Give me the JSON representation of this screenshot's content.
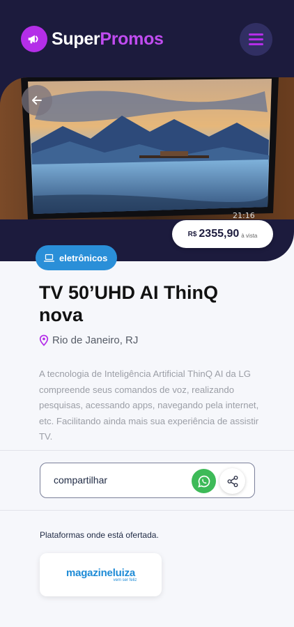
{
  "brand": {
    "super": "Super",
    "promos": "Promos"
  },
  "product": {
    "price_currency": "R$",
    "price_value": "2355,90",
    "price_suffix": "à vista",
    "category": "eletrônicos",
    "title": "TV 50’UHD AI ThinQ nova",
    "location": "Rio de Janeiro, RJ",
    "description": "A tecnologia de Inteligência Artificial ThinQ AI da LG compreende seus comandos de voz, realizando pesquisas, acessando apps, navegando pela internet, etc. Facilitando ainda mais sua experiência de assistir TV.",
    "tv_clock": "21:16"
  },
  "share": {
    "label": "compartilhar"
  },
  "platforms": {
    "label": "Plataformas onde está ofertada.",
    "stores": [
      {
        "name": "magazineluiza",
        "tagline": "vem ser feliz"
      }
    ]
  },
  "icons": {
    "logo": "megaphone-icon",
    "menu": "menu-icon",
    "back": "arrow-left-icon",
    "category": "laptop-icon",
    "location": "map-pin-icon",
    "whatsapp": "whatsapp-icon",
    "share": "share-icon"
  },
  "colors": {
    "header_bg": "#1c1b3d",
    "brand_accent": "#c04cf0",
    "category_bg": "#2a8fd8",
    "whatsapp": "#3dba58",
    "store_blue": "#1e8bd6"
  }
}
